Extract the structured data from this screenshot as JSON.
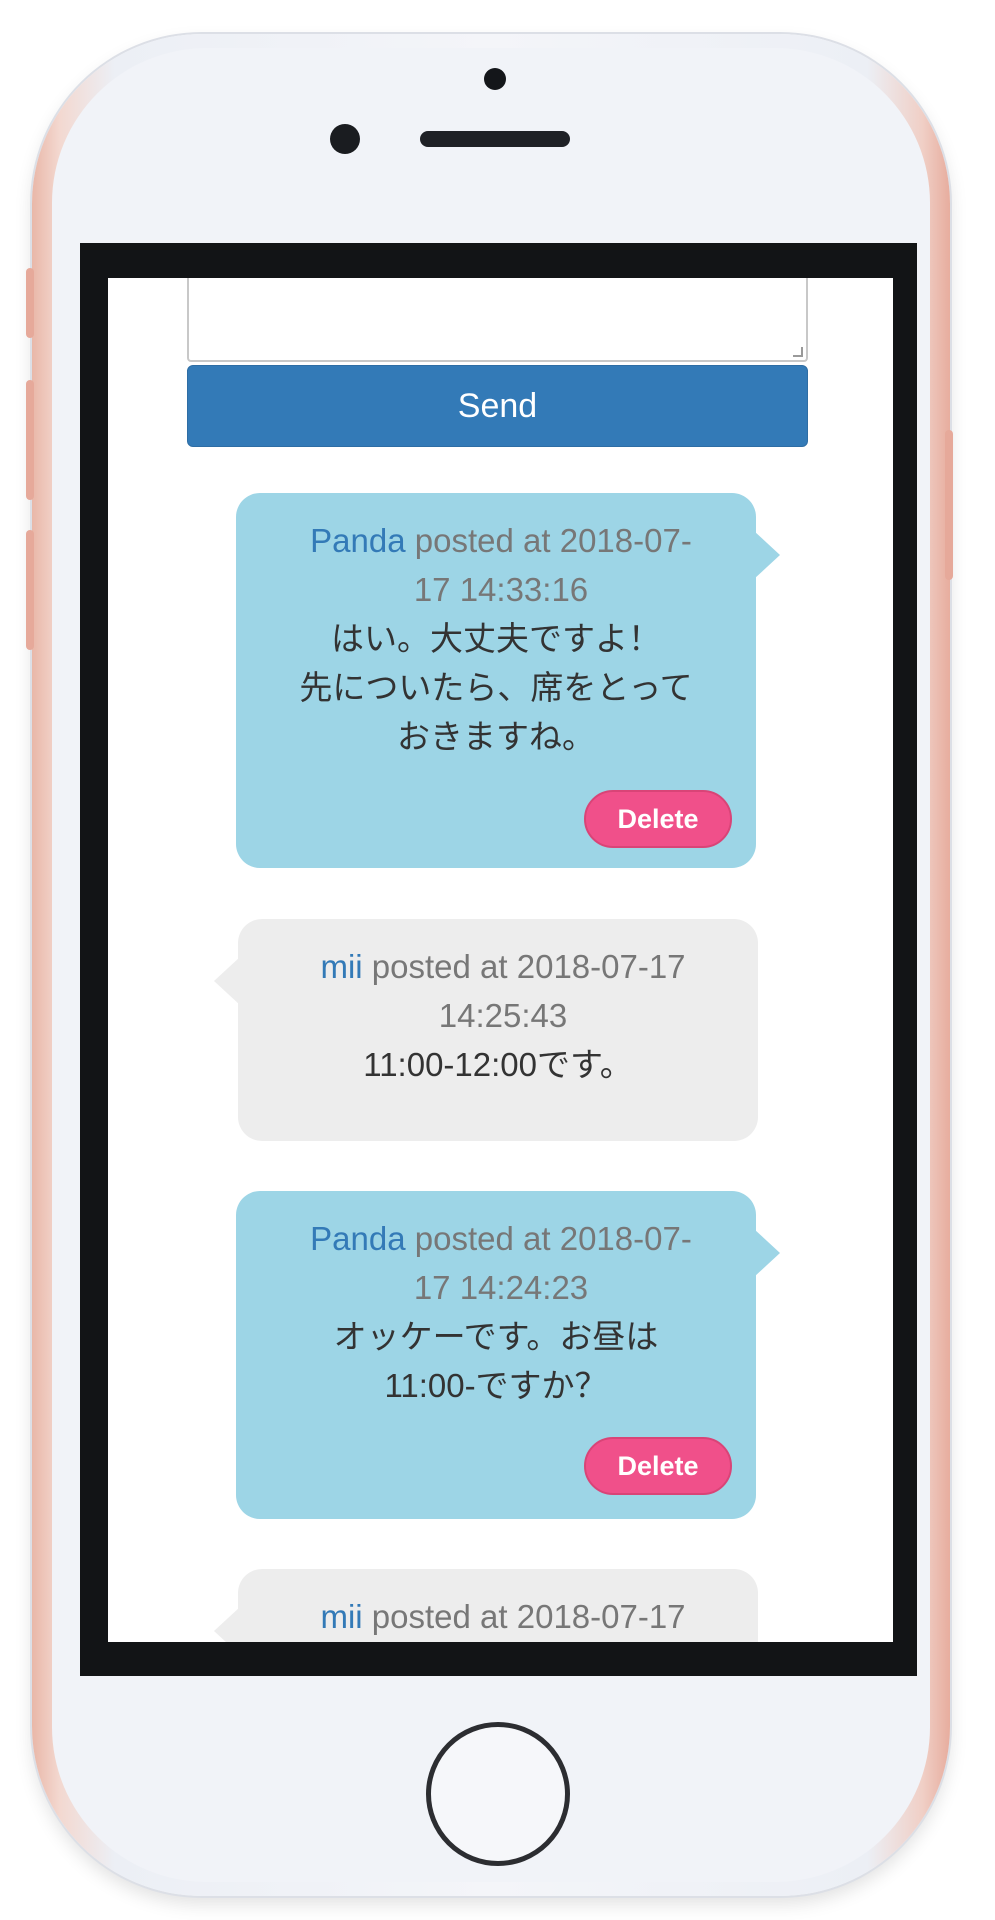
{
  "compose": {
    "send_label": "Send"
  },
  "posted_label": "posted at",
  "delete_label": "Delete",
  "messages": [
    {
      "author": "Panda",
      "timestamp": "2018-07-17 14:33:16",
      "header_line1_ts": "2018-07-",
      "header_line2_ts": "17 14:33:16",
      "body_lines": [
        "はい。大丈夫ですよ！",
        "先についたら、席をとって",
        "おきますね。"
      ],
      "own": true
    },
    {
      "author": "mii",
      "timestamp": "2018-07-17 14:25:43",
      "header_line1_ts": "2018-07-17",
      "header_line2_ts": "14:25:43",
      "body_lines": [
        "11:00-12:00です。"
      ],
      "own": false
    },
    {
      "author": "Panda",
      "timestamp": "2018-07-17 14:24:23",
      "header_line1_ts": "2018-07-",
      "header_line2_ts": "17 14:24:23",
      "body_lines": [
        "オッケーです。お昼は",
        "11:00-ですか？"
      ],
      "own": true
    },
    {
      "author": "mii",
      "header_line1_ts": "2018-07-17",
      "own": false
    }
  ],
  "colors": {
    "own_bubble": "#9dd5e6",
    "other_bubble": "#ededed",
    "send_button": "#337ab7",
    "delete_button": "#f0508a",
    "author_link": "#337ab7"
  },
  "icons": {
    "camera": "front-camera-icon",
    "home": "home-button-icon"
  }
}
